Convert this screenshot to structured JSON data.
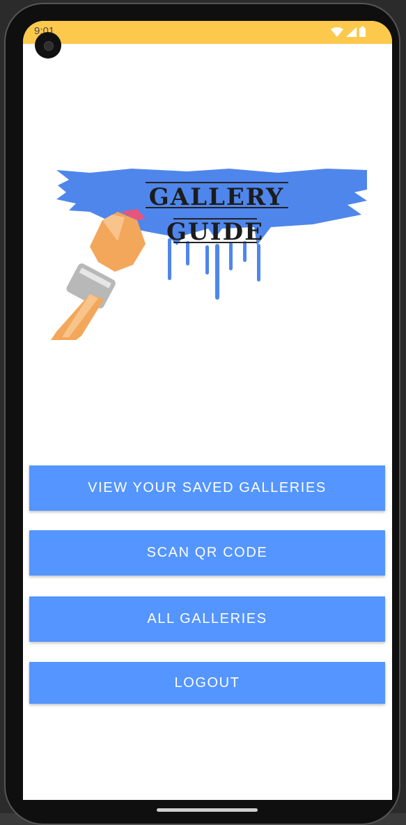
{
  "status_bar": {
    "time": "9:01",
    "icons": [
      "wifi-icon",
      "signal-icon",
      "battery-icon"
    ],
    "color": "#fdc94c"
  },
  "logo": {
    "line1": "GALLERY",
    "line2": "GUIDE"
  },
  "buttons": {
    "saved_galleries": "VIEW YOUR SAVED GALLERIES",
    "scan_qr": "SCAN QR CODE",
    "all_galleries": "ALL GALLERIES",
    "logout": "LOGOUT"
  },
  "colors": {
    "button": "#5495ff",
    "logo_paint": "#4f86ec",
    "brush_handle": "#f3a75a"
  }
}
